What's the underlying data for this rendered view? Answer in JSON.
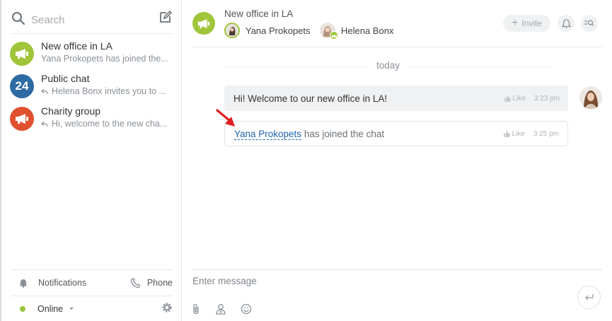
{
  "colors": {
    "accent_green": "#a0c53a",
    "accent_blue": "#2e6aa3",
    "accent_red": "#e0502f",
    "link_blue": "#2067b0",
    "online_dot": "#9ac438",
    "arrow_red": "#e02020"
  },
  "sidebar": {
    "search_placeholder": "Search",
    "chats": [
      {
        "title": "New office in LA",
        "subtitle": "Yana Prokopets has joined the...",
        "avatar_icon": "megaphone-icon",
        "avatar_color": "#a0c53a",
        "has_reply_icon": false
      },
      {
        "title": "Public chat",
        "subtitle": "Helena Bonx invites you to ...",
        "avatar_icon": "24-icon",
        "avatar_text": "24",
        "avatar_color": "#2e6aa3",
        "has_reply_icon": true
      },
      {
        "title": "Charity group",
        "subtitle": "Hi, welcome to the new cha...",
        "avatar_icon": "megaphone-icon",
        "avatar_color": "#e0502f",
        "has_reply_icon": true
      }
    ],
    "notifications_label": "Notifications",
    "phone_label": "Phone",
    "status_label": "Online"
  },
  "header": {
    "title": "New office in LA",
    "members": [
      {
        "name": "Yana Prokopets"
      },
      {
        "name": "Helena Bonx"
      }
    ],
    "invite_label": "Invite"
  },
  "messages": {
    "date_label": "today",
    "items": [
      {
        "text": "Hi! Welcome to our new office in LA!",
        "like_label": "Like",
        "time": "3:23 pm"
      },
      {
        "user": "Yana Prokopets",
        "text": "has joined the chat",
        "like_label": "Like",
        "time": "3:25 pm"
      }
    ]
  },
  "composer": {
    "placeholder": "Enter message"
  }
}
